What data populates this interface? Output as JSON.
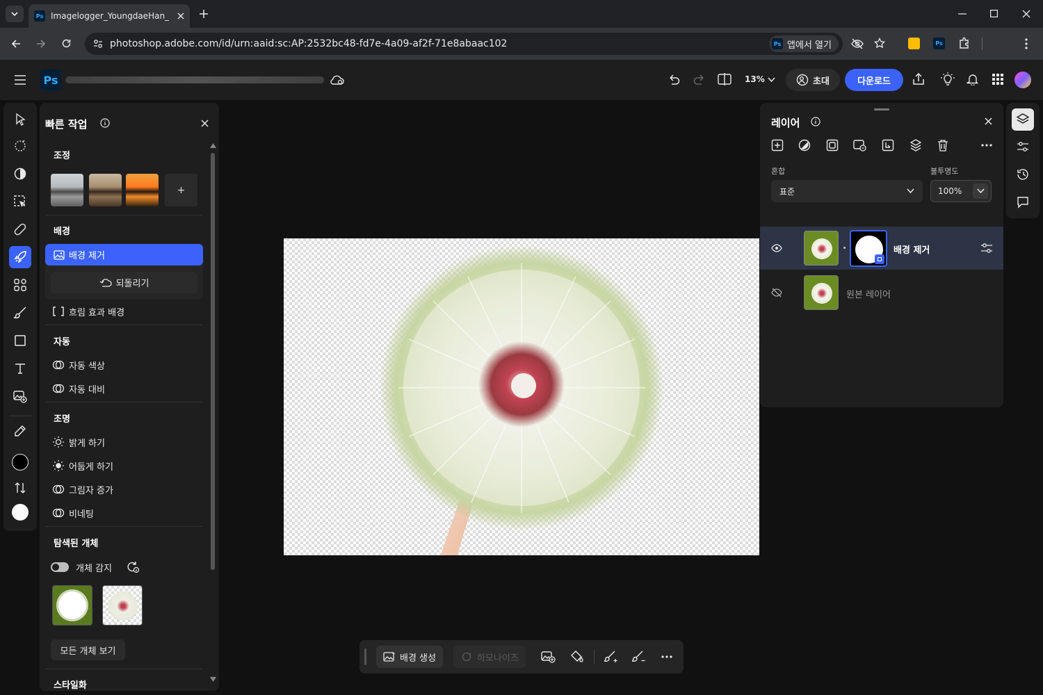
{
  "browser": {
    "tab_title": "Imagelogger_YoungdaeHan_NI",
    "url": "photoshop.adobe.com/id/urn:aaid:sc:AP:2532bc48-fd7e-4a09-af2f-71e8abaac102",
    "open_in_app": "앱에서 열기",
    "ps_badge": "Ps"
  },
  "header": {
    "logo": "Ps",
    "zoom": "13%",
    "invite": "초대",
    "download": "다운로드"
  },
  "quick_actions": {
    "title": "빠른 작업",
    "adjust": {
      "heading": "조정",
      "add": "+"
    },
    "background": {
      "heading": "배경",
      "remove": "배경 제거",
      "undo": "되돌리기",
      "blur": "흐림 효과 배경"
    },
    "auto": {
      "heading": "자동",
      "color": "자동 색상",
      "contrast": "자동 대비"
    },
    "lighting": {
      "heading": "조명",
      "brighten": "밝게 하기",
      "darken": "어둡게 하기",
      "shadow": "그림자 증가",
      "vignette": "비네팅"
    },
    "objects": {
      "heading": "탐색된 개체",
      "detect": "개체 감지",
      "view_all": "모든 개체 보기"
    },
    "styling": {
      "heading": "스타일화"
    }
  },
  "layers": {
    "title": "레이어",
    "blend_label": "혼합",
    "blend_value": "표준",
    "opacity_label": "불투명도",
    "opacity_value": "100%",
    "items": [
      {
        "name": "배경 제거",
        "visible": true,
        "selected": true
      },
      {
        "name": "원본 레이어",
        "visible": false,
        "selected": false
      }
    ]
  },
  "context_bar": {
    "generate_bg": "배경 생성",
    "harmonize": "하모나이즈"
  },
  "colors": {
    "accent": "#3b63fb",
    "panel": "#1e1e1e",
    "app_bg": "#111111"
  }
}
